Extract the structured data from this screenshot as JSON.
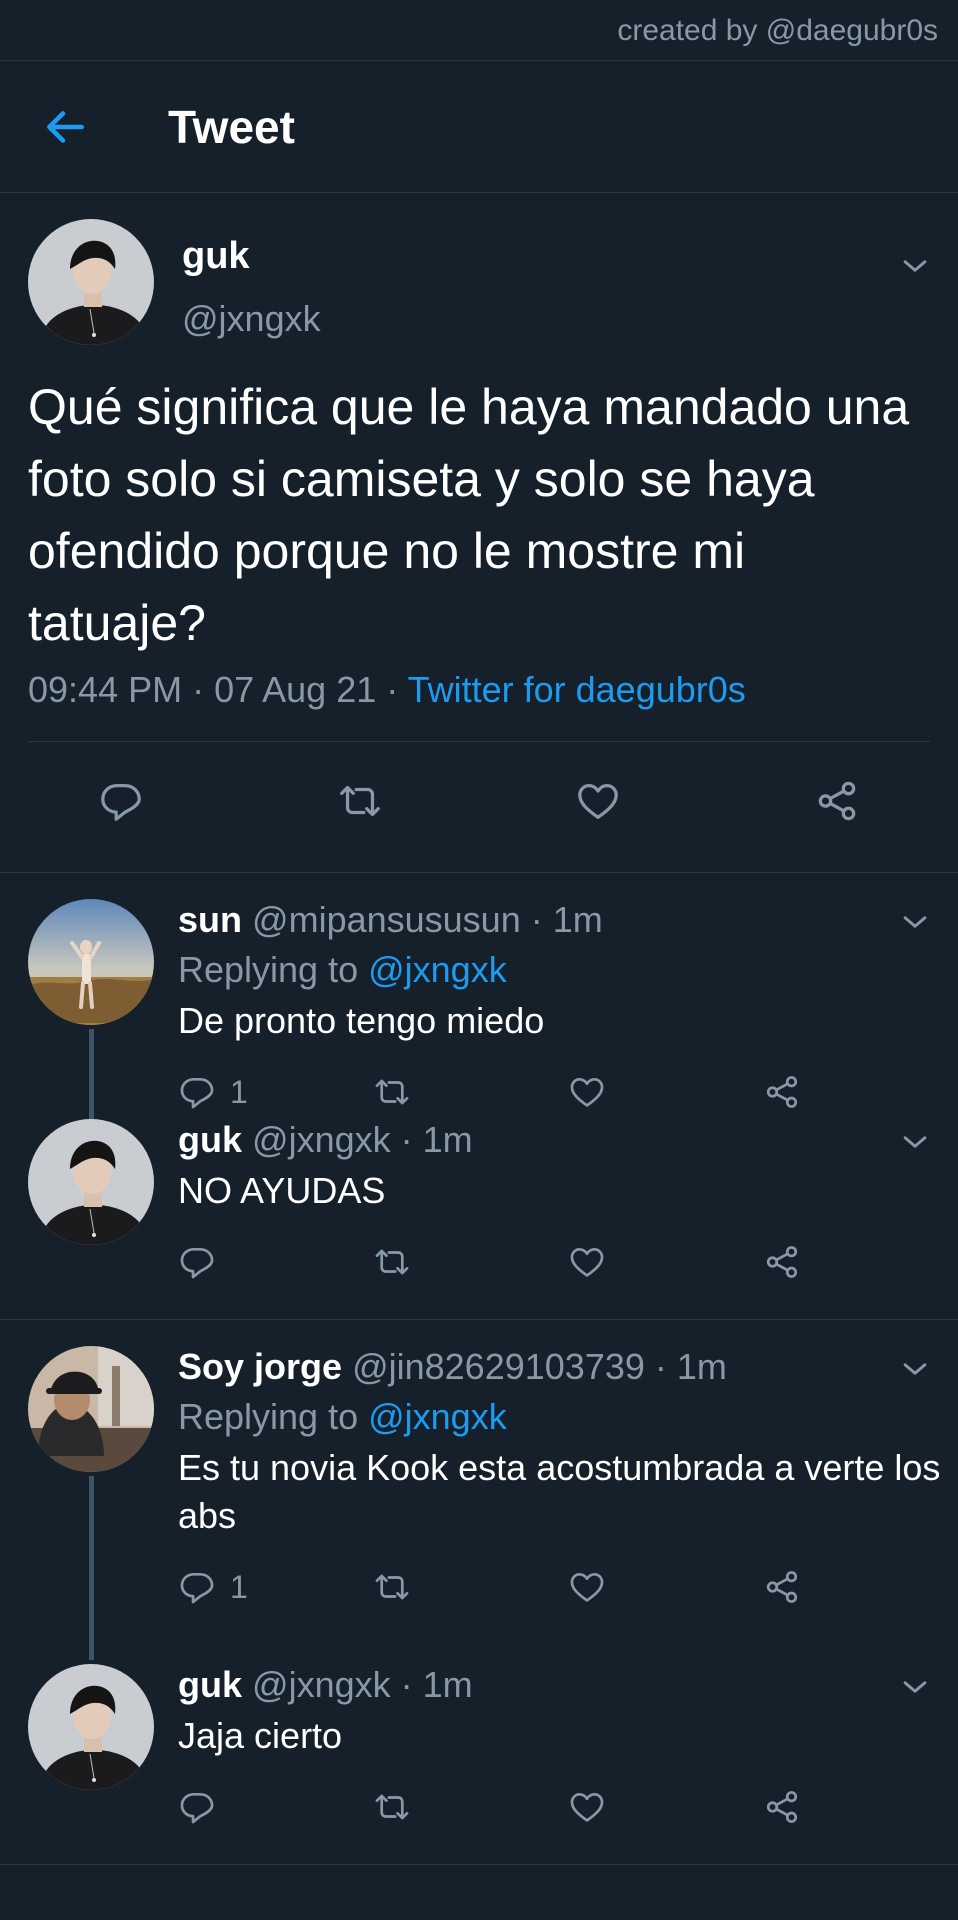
{
  "credit": "created by @daegubr0s",
  "header": {
    "title": "Tweet"
  },
  "main_tweet": {
    "name": "guk",
    "handle": "@jxngxk",
    "text": "Qué significa que le haya mandado una foto solo si camiseta y solo se haya ofendido porque no le mostre mi tatuaje?",
    "time": "09:44 PM",
    "date": "07 Aug 21",
    "separator": " · ",
    "source": "Twitter for daegubr0s"
  },
  "replies": [
    {
      "name": "sun",
      "handle": "@mipansususun",
      "time": "1m",
      "replying_prefix": "Replying to ",
      "replying_to": "@jxngxk",
      "text": "De pronto tengo miedo",
      "reply_count": "1"
    },
    {
      "name": "guk",
      "handle": "@jxngxk",
      "time": "1m",
      "text": "NO AYUDAS"
    },
    {
      "name": "Soy jorge",
      "handle": "@jin82629103739",
      "time": "1m",
      "replying_prefix": "Replying to ",
      "replying_to": "@jxngxk",
      "text": "Es tu novia Kook esta acostumbrada a verte los abs",
      "reply_count": "1"
    },
    {
      "name": "guk",
      "handle": "@jxngxk",
      "time": "1m",
      "text": "Jaja cierto"
    }
  ],
  "icons": {
    "back": "arrow-left-icon",
    "more": "chevron-down-icon",
    "reply": "comment-icon",
    "retweet": "retweet-icon",
    "like": "heart-icon",
    "share": "share-icon"
  },
  "colors": {
    "background": "#15202b",
    "accent": "#1d9bf0",
    "secondary_text": "#8899a6",
    "divider": "#2b3a48"
  }
}
